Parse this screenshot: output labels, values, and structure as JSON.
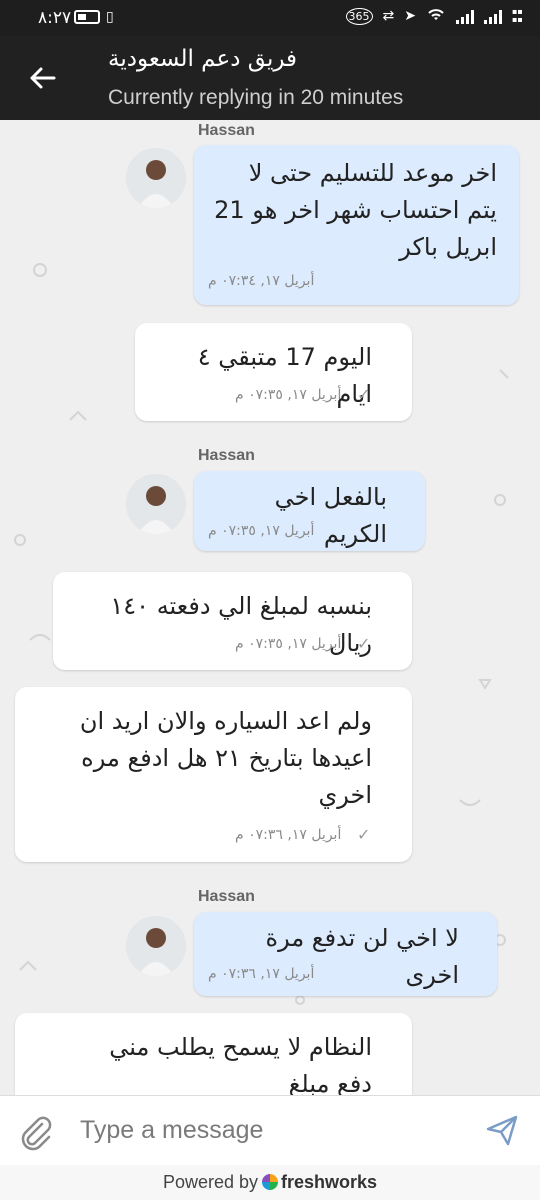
{
  "status_bar": {
    "time": "٨:٢٧"
  },
  "header": {
    "title": "فريق دعم السعودية",
    "subtitle": "Currently replying in 20 minutes"
  },
  "messages": [
    {
      "sender": "Hassan",
      "from": "agent",
      "text": "اخر موعد للتسليم حتى لا يتم احتساب شهر اخر هو 21 ابريل باكر",
      "time": "أبريل ١٧, ٠٧:٣٤ م"
    },
    {
      "from": "user",
      "text": "اليوم 17 متبقي ٤ ايام",
      "time": "أبريل ١٧, ٠٧:٣٥ م"
    },
    {
      "sender": "Hassan",
      "from": "agent",
      "text": "بالفعل اخي الكريم",
      "time": "أبريل ١٧, ٠٧:٣٥ م"
    },
    {
      "from": "user",
      "text": "بنسبه لمبلغ الي دفعته ١٤٠ ريال",
      "time": "أبريل ١٧, ٠٧:٣٥ م"
    },
    {
      "from": "user",
      "text": "ولم اعد السياره والان اريد ان اعيدها بتاريخ ٢١ هل ادفع مره اخري",
      "time": "أبريل ١٧, ٠٧:٣٦ م"
    },
    {
      "sender": "Hassan",
      "from": "agent",
      "text": "لا اخي لن تدفع مرة اخرى",
      "time": "أبريل ١٧, ٠٧:٣٦ م"
    },
    {
      "from": "user",
      "text": "النظام لا يسمح يطلب مني دفع مبلغ"
    }
  ],
  "composer": {
    "placeholder": "Type a message"
  },
  "footer": {
    "powered_by": "Powered by",
    "brand": "freshworks"
  },
  "colors": {
    "agent_bubble": "#dcebfd",
    "user_bubble": "#ffffff",
    "header": "#212121",
    "send_icon": "#7a9cc6"
  }
}
